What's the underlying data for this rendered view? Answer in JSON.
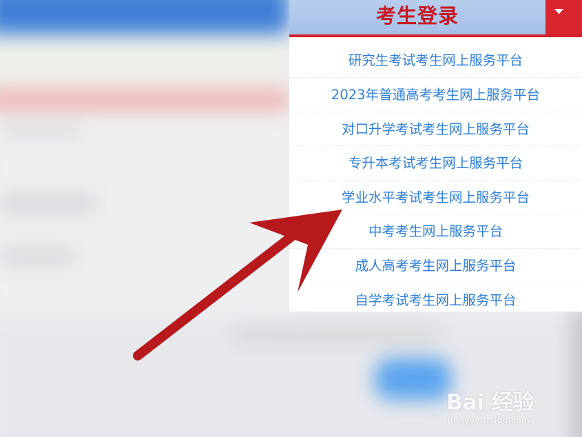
{
  "dropdown": {
    "title": "考生登录",
    "toggle_icon": "caret-down-icon",
    "items": [
      {
        "label": "研究生考试考生网上服务平台"
      },
      {
        "label": "2023年普通高考考生网上服务平台"
      },
      {
        "label": "对口升学考试考生网上服务平台"
      },
      {
        "label": "专升本考试考生网上服务平台"
      },
      {
        "label": "学业水平考试考生网上服务平台"
      },
      {
        "label": "中考考生网上服务平台"
      },
      {
        "label": "成人高考考生网上服务平台"
      },
      {
        "label": "自学考试考生网上服务平台"
      }
    ]
  },
  "colors": {
    "header_bg": "#a6c0e8",
    "title_red": "#c8171f",
    "toggle_red": "#d9262e",
    "link_blue": "#2d7fd9",
    "arrow_red": "#b7191c"
  },
  "watermark": {
    "brand": "Bai 经验",
    "url": "jingyan.baidu.com"
  }
}
